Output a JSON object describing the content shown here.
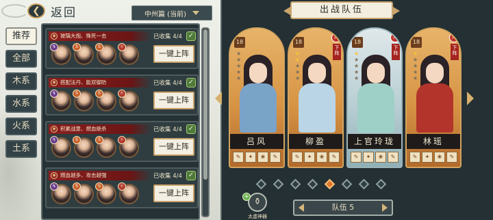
{
  "header": {
    "back_label": "返回"
  },
  "chapter_selector": {
    "label": "中州篇 (当前)"
  },
  "tabs": [
    {
      "label": "推荐",
      "active": true
    },
    {
      "label": "全部",
      "active": false
    },
    {
      "label": "木系",
      "active": false
    },
    {
      "label": "水系",
      "active": false
    },
    {
      "label": "火系",
      "active": false
    },
    {
      "label": "土系",
      "active": false
    }
  ],
  "formations": [
    {
      "title": "玻璃大炮、殊死一击",
      "collected": "已收集 4/4",
      "deploy_label": "一键上阵",
      "hero_elements": [
        "purple",
        "orange",
        "orange",
        "red"
      ],
      "hero_icons": [
        "↯",
        "S",
        "S",
        "☼"
      ]
    },
    {
      "title": "搭配法丹、能双御防",
      "collected": "已收集 4/4",
      "deploy_label": "一键上阵",
      "hero_elements": [
        "purple",
        "orange",
        "orange",
        "red"
      ],
      "hero_icons": [
        "↯",
        "S",
        "S",
        "☼"
      ]
    },
    {
      "title": "积累战意、燃血绝杀",
      "collected": "已收集 4/4",
      "deploy_label": "一键上阵",
      "hero_elements": [
        "purple",
        "orange",
        "orange",
        "red"
      ],
      "hero_icons": [
        "↯",
        "S",
        "S",
        "☼"
      ]
    },
    {
      "title": "燃血越多、攻击越强",
      "collected": "已收集 4/4",
      "deploy_label": "一键上阵",
      "hero_elements": [
        "purple",
        "orange",
        "orange",
        "red"
      ],
      "hero_icons": [
        "↯",
        "S",
        "S",
        "☼"
      ]
    }
  ],
  "team": {
    "title": "出战队伍",
    "remove_label": "下阵",
    "members": [
      {
        "name": "吕风",
        "level": "18",
        "stars": 0,
        "removable": false,
        "theme": "gold",
        "body_color": "#7aa3c8"
      },
      {
        "name": "柳盈",
        "level": "18",
        "stars": 2,
        "removable": true,
        "theme": "gold",
        "body_color": "#b9d5e6"
      },
      {
        "name": "上官玲珑",
        "level": "18",
        "stars": 1,
        "removable": true,
        "theme": "blue",
        "body_color": "#9fd0c8"
      },
      {
        "name": "林瑶",
        "level": "18",
        "stars": 1,
        "removable": true,
        "theme": "gold",
        "body_color": "#b3342b"
      }
    ],
    "equip_icons": [
      "✎",
      "✦",
      "❀"
    ],
    "page_count": 8,
    "active_page": 4,
    "team_label": "队伍 5"
  },
  "treasure": {
    "label": "太虚神器"
  },
  "colors": {
    "accent": "#c9a46c",
    "panel": "#243034",
    "deploy_bg": "#f3efe2",
    "remove": "#c0312a"
  }
}
